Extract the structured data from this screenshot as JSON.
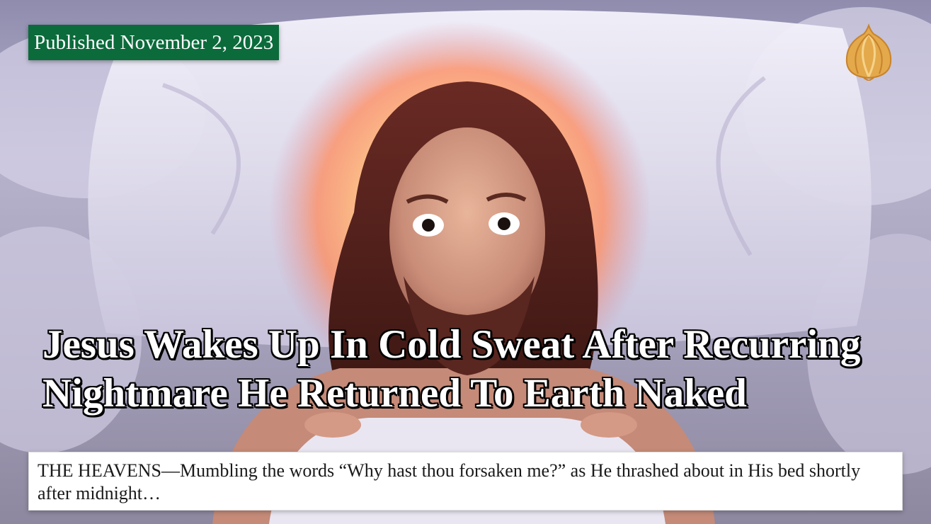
{
  "article": {
    "published_label": "Published November 2, 2023",
    "headline": "Jesus Wakes Up In Cold Sweat After Recurring Nightmare He Returned To Earth Naked",
    "excerpt": "THE HEAVENS—Mumbling the words “Why hast thou forsaken me?” as He thrashed about in His bed shortly after midnight…"
  },
  "brand": {
    "logo_icon": "onion-logo-icon",
    "badge_color": "#0b6b3b",
    "logo_color": "#e3a94b"
  },
  "image": {
    "subject_icon": "startled-man-in-bed-photo"
  }
}
